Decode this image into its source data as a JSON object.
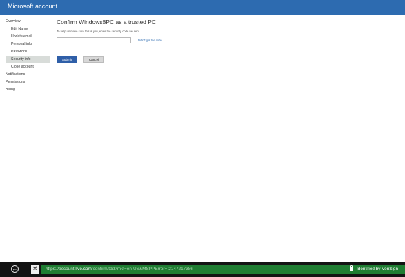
{
  "window": {
    "title": "Microsoft account"
  },
  "sidebar": {
    "items": [
      {
        "label": "Overview",
        "level": "top",
        "selected": false
      },
      {
        "label": "Edit Name",
        "level": "sub",
        "selected": false
      },
      {
        "label": "Update email",
        "level": "sub",
        "selected": false
      },
      {
        "label": "Personal info",
        "level": "sub",
        "selected": false
      },
      {
        "label": "Password",
        "level": "sub",
        "selected": false
      },
      {
        "label": "Security info",
        "level": "sub",
        "selected": true
      },
      {
        "label": "Close account",
        "level": "sub",
        "selected": false
      },
      {
        "label": "Notifications",
        "level": "top",
        "selected": false
      },
      {
        "label": "Permissions",
        "level": "top",
        "selected": false
      },
      {
        "label": "Billing",
        "level": "top",
        "selected": false
      }
    ]
  },
  "main": {
    "title": "Confirm Windows8PC as a trusted PC",
    "intro": "To help us make sure this is you, enter the security code we sent.",
    "code_input": {
      "value": "",
      "placeholder": ""
    },
    "resend_link": "Didn't get the code",
    "submit_label": "Submit",
    "cancel_label": "Cancel"
  },
  "addressbar": {
    "url_prefix": "https://account.",
    "url_domain": "live.com",
    "url_path": "/confirm/tdd?mkt=en-US&MSPPError=-2147217386",
    "identity": "Identified by VeriSign",
    "site_icon_glyph": "⌘",
    "back_glyph": "←",
    "icons": [
      "back-icon",
      "site-icon",
      "lock-icon"
    ]
  },
  "colors": {
    "titlebar": "#2d6bb0",
    "address_bg": "#131313",
    "url_field": "#1f7d32",
    "submit": "#2f5fa8",
    "selected_nav": "#d8dcd9"
  }
}
